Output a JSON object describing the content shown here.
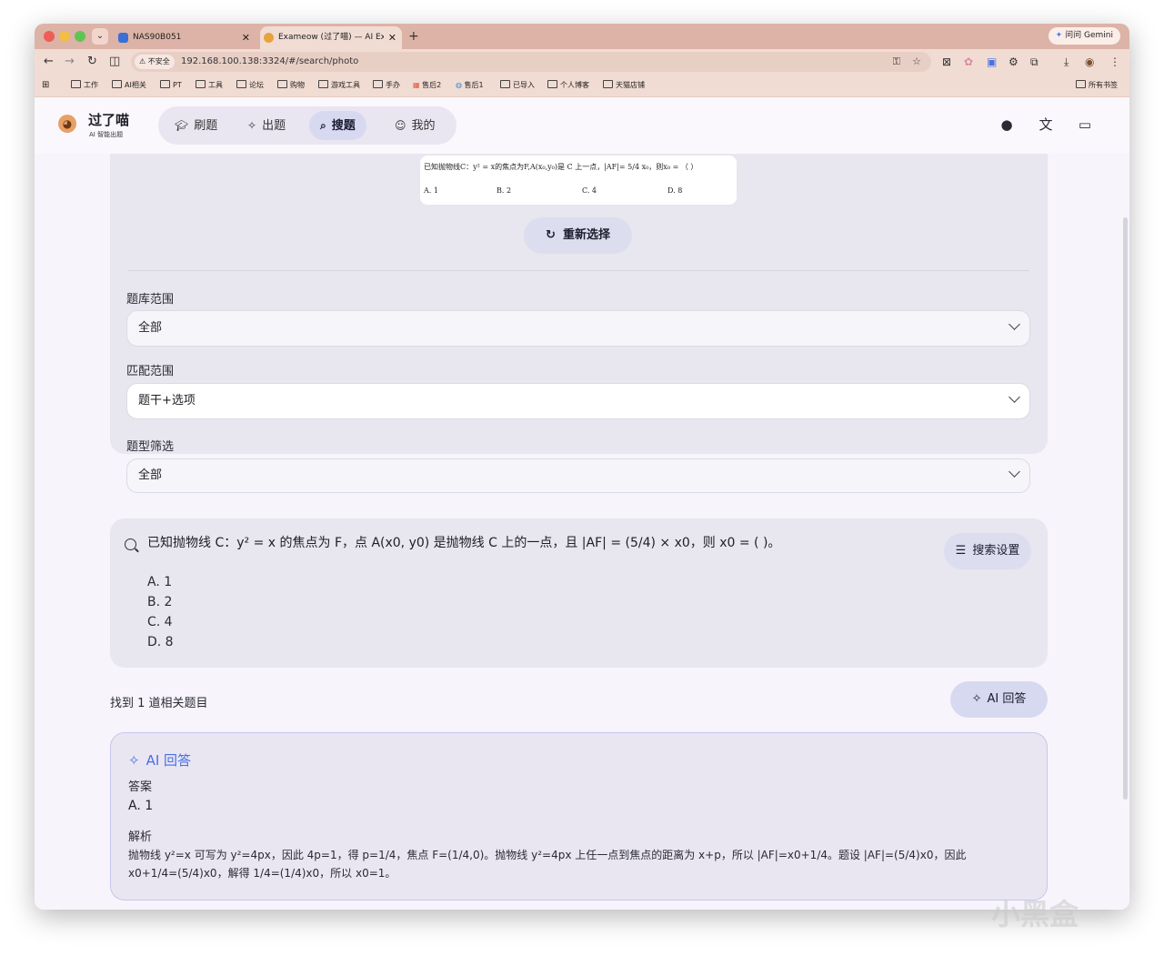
{
  "browser": {
    "tabs": [
      {
        "title": "NAS90B051",
        "close": "✕"
      },
      {
        "title": "Exameow (过了喵) — AI Exam",
        "close": "✕"
      }
    ],
    "new_tab": "+",
    "gemini_label": "问问 Gemini",
    "insecure_label": "不安全",
    "url": "192.168.100.138:3324/#/search/photo",
    "bookmarks": [
      "工作",
      "AI相关",
      "PT",
      "工具",
      "论坛",
      "购物",
      "游戏工具",
      "手办",
      "售后2",
      "售后1",
      "已导入",
      "个人博客",
      "天猫店铺"
    ],
    "all_bookmarks": "所有书签"
  },
  "app": {
    "brand": "过了喵",
    "brand_sub": "AI 智能出题",
    "nav": [
      {
        "label": "刷题",
        "icon": "graduation-cap-icon"
      },
      {
        "label": "出题",
        "icon": "sparkles-icon"
      },
      {
        "label": "搜题",
        "icon": "search-icon",
        "active": true
      },
      {
        "label": "我的",
        "icon": "user-circle-icon"
      }
    ]
  },
  "photo": {
    "question_line": "已知抛物线C：y² = x的焦点为F,A(x₀,y₀)是 C 上一点，|AF|= 5/4 x₀，则x₀ = （ ）",
    "options": [
      "A. 1",
      "B. 2",
      "C. 4",
      "D. 8"
    ],
    "reselect_label": "重新选择"
  },
  "filters": {
    "bank_label": "题库范围",
    "bank_value": "全部",
    "match_label": "匹配范围",
    "match_value": "题干+选项",
    "type_label": "题型筛选",
    "type_value": "全部"
  },
  "query": {
    "text": "已知抛物线 C：y² = x 的焦点为 F，点 A(x0, y0) 是抛物线 C 上的一点，且 |AF| = (5/4) × x0，则 x0 = ( )。",
    "options": [
      "A. 1",
      "B. 2",
      "C. 4",
      "D. 8"
    ],
    "settings_label": "搜索设置"
  },
  "results": {
    "found_text": "找到 1 道相关题目",
    "ai_button": "AI 回答"
  },
  "ai_answer": {
    "title": "AI 回答",
    "answer_label": "答案",
    "answer": "A. 1",
    "analysis_label": "解析",
    "analysis": "抛物线 y²=x 可写为 y²=4px，因此 4p=1，得 p=1/4，焦点 F=(1/4,0)。抛物线 y²=4px 上任一点到焦点的距离为 x+p，所以 |AF|=x0+1/4。题设 |AF|=(5/4)x0，因此 x0+1/4=(5/4)x0，解得 1/4=(1/4)x0，所以 x0=1。"
  },
  "watermark": "小黑盒"
}
